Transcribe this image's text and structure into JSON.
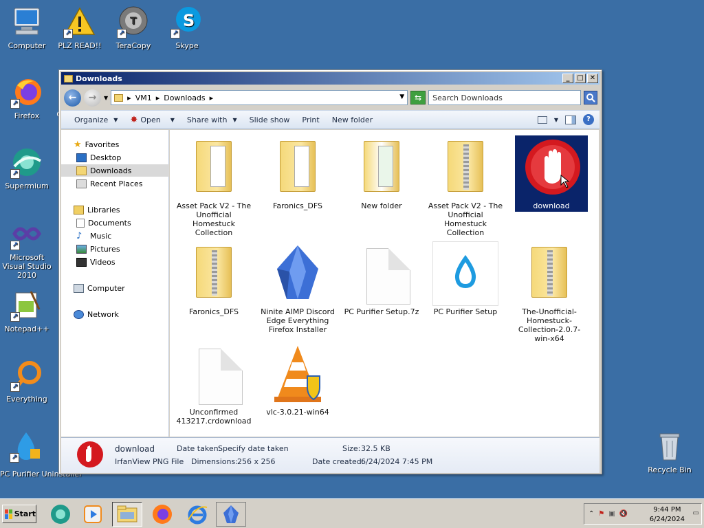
{
  "desktop": {
    "icons": [
      {
        "label": "Computer",
        "icon": "computer-icon"
      },
      {
        "label": "PLZ READ!!",
        "icon": "warning-icon"
      },
      {
        "label": "TeraCopy",
        "icon": "teracopy-icon"
      },
      {
        "label": "Skype",
        "icon": "skype-icon"
      },
      {
        "label": "Firefox",
        "icon": "firefox-icon"
      },
      {
        "label": "Supermium",
        "icon": "supermium-icon"
      },
      {
        "label": "Microsoft Visual Studio 2010",
        "icon": "visual-studio-icon"
      },
      {
        "label": "Notepad++",
        "icon": "notepad-plus-plus-icon"
      },
      {
        "label": "Everything",
        "icon": "everything-icon"
      },
      {
        "label": "PC Purifier Uninstaller",
        "icon": "pc-purifier-icon"
      },
      {
        "label": "Recycle Bin",
        "icon": "recycle-bin-icon"
      }
    ],
    "partial_label": "C"
  },
  "window": {
    "title": "Downloads",
    "buttons": {
      "minimize": "_",
      "maximize": "□",
      "close": "✕"
    },
    "address": {
      "segments": [
        "VM1",
        "Downloads"
      ],
      "separator": "▸"
    },
    "search_placeholder": "Search Downloads",
    "toolbar": {
      "organize": "Organize",
      "open": "Open",
      "share_with": "Share with",
      "slide_show": "Slide show",
      "print": "Print",
      "new_folder": "New folder"
    },
    "nav": {
      "favorites": "Favorites",
      "desktop": "Desktop",
      "downloads": "Downloads",
      "recent_places": "Recent Places",
      "libraries": "Libraries",
      "documents": "Documents",
      "music": "Music",
      "pictures": "Pictures",
      "videos": "Videos",
      "computer": "Computer",
      "network": "Network"
    },
    "files": [
      {
        "name": "Asset Pack V2 - The Unofficial Homestuck Collection",
        "type": "folder"
      },
      {
        "name": "Faronics_DFS",
        "type": "folder"
      },
      {
        "name": "New folder",
        "type": "folder"
      },
      {
        "name": "Asset Pack V2 - The Unofficial Homestuck Collection",
        "type": "zip"
      },
      {
        "name": "download",
        "type": "png"
      },
      {
        "name": "Faronics_DFS",
        "type": "zip"
      },
      {
        "name": "Ninite AIMP Discord Edge Everything Firefox Installer",
        "type": "exe"
      },
      {
        "name": "PC Purifier Setup.7z",
        "type": "file"
      },
      {
        "name": "PC Purifier Setup",
        "type": "exe"
      },
      {
        "name": "The-Unofficial-Homestuck-Collection-2.0.7-win-x64",
        "type": "zip"
      },
      {
        "name": "Unconfirmed 413217.crdownload",
        "type": "file"
      },
      {
        "name": "vlc-3.0.21-win64",
        "type": "exe"
      }
    ],
    "details": {
      "name": "download",
      "type": "IrfanView PNG File",
      "date_taken_label": "Date taken:",
      "date_taken": "Specify date taken",
      "size_label": "Size:",
      "size": "32.5 KB",
      "dimensions_label": "Dimensions:",
      "dimensions": "256 x 256",
      "date_created_label": "Date created:",
      "date_created": "6/24/2024 7:45 PM"
    }
  },
  "taskbar": {
    "start": "Start",
    "items": [
      "supermium-icon",
      "media-player-icon",
      "explorer-icon",
      "firefox-icon",
      "internet-explorer-icon",
      "ninite-icon"
    ],
    "time": "9:44 PM",
    "date": "6/24/2024"
  }
}
